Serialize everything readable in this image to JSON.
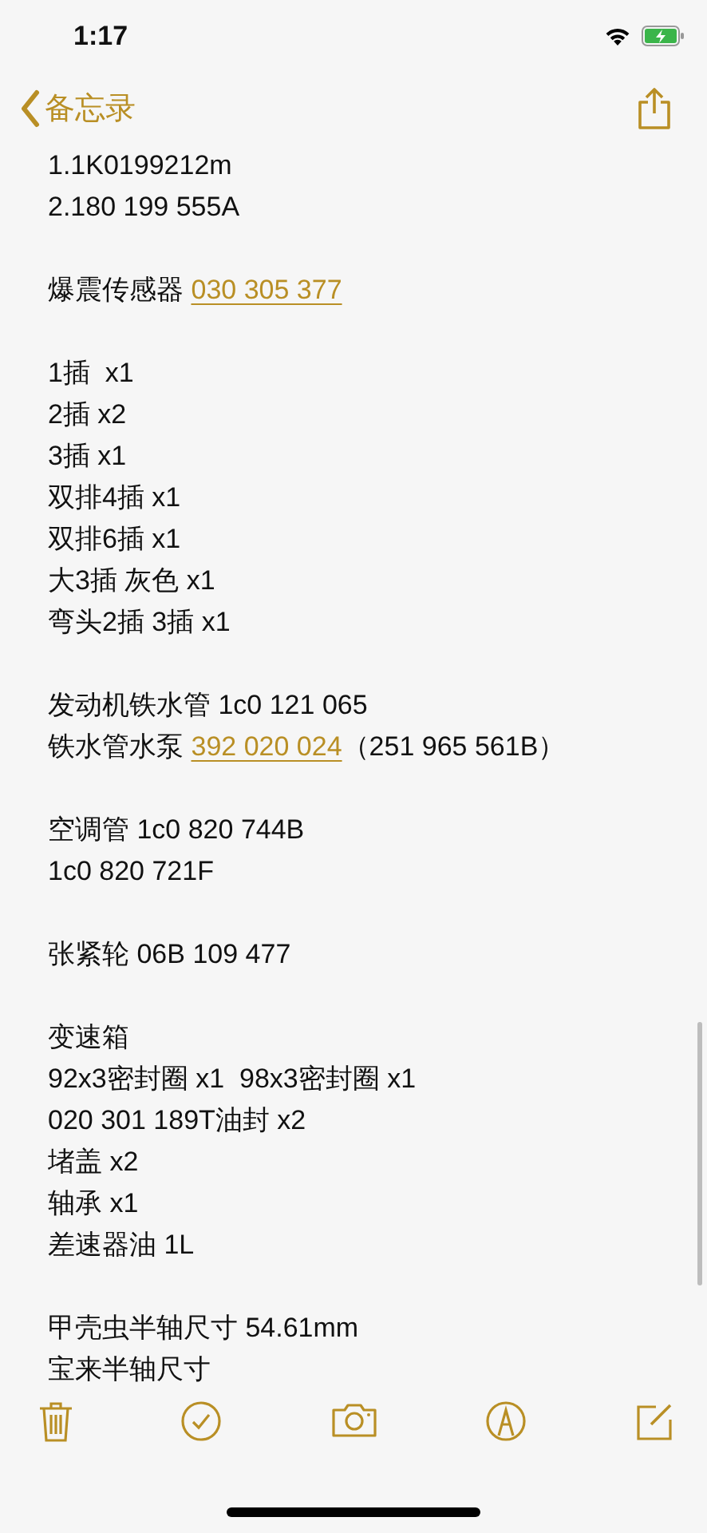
{
  "status_bar": {
    "time": "1:17"
  },
  "nav": {
    "back_label": "备忘录"
  },
  "note": {
    "paragraphs": [
      [
        [
          {
            "text": "1.1K0199212m"
          }
        ],
        [
          {
            "text": "2.180 199 555A"
          }
        ]
      ],
      [
        [
          {
            "text": "爆震传感器 "
          },
          {
            "text": "030 305 377",
            "kind": "link"
          }
        ]
      ],
      [
        [
          {
            "text": "1插  x1"
          }
        ],
        [
          {
            "text": "2插 x2"
          }
        ],
        [
          {
            "text": "3插 x1"
          }
        ],
        [
          {
            "text": "双排4插 x1"
          }
        ],
        [
          {
            "text": "双排6插 x1"
          }
        ],
        [
          {
            "text": "大3插 灰色 x1"
          }
        ],
        [
          {
            "text": "弯头2插 3插 x1"
          }
        ]
      ],
      [
        [
          {
            "text": "发动机铁水管 1c0 121 065"
          }
        ],
        [
          {
            "text": "铁水管水泵 "
          },
          {
            "text": "392 020 024",
            "kind": "link"
          },
          {
            "text": "（251 965 561B）"
          }
        ]
      ],
      [
        [
          {
            "text": "空调管 1c0 820 744B"
          }
        ],
        [
          {
            "text": "1c0 820 721F"
          }
        ]
      ],
      [
        [
          {
            "text": "张紧轮 06B 109 477"
          }
        ]
      ],
      [
        [
          {
            "text": "变速箱"
          }
        ],
        [
          {
            "text": "92x3密封圈 x1  98x3密封圈 x1"
          }
        ],
        [
          {
            "text": "020 301 189T油封 x2"
          }
        ],
        [
          {
            "text": "堵盖 x2"
          }
        ],
        [
          {
            "text": "轴承 x1"
          }
        ],
        [
          {
            "text": "差速器油 1L"
          }
        ]
      ],
      [
        [
          {
            "text": "甲壳虫半轴尺寸 54.61mm"
          }
        ],
        [
          {
            "text": "宝来半轴尺寸"
          }
        ]
      ]
    ]
  }
}
